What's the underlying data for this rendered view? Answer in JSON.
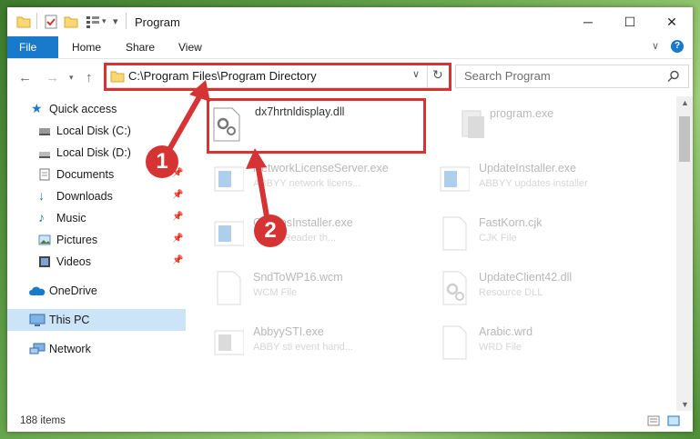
{
  "window": {
    "title": "Program"
  },
  "ribbon": {
    "tabs": [
      "File",
      "Home",
      "Share",
      "View"
    ]
  },
  "address": {
    "path": "C:\\Program Files\\Program Directory"
  },
  "search": {
    "placeholder": "Search Program"
  },
  "sidebar": {
    "items": [
      {
        "label": "Quick access",
        "icon": "star-icon",
        "pinned": false
      },
      {
        "label": "Local Disk (C:)",
        "icon": "drive-icon",
        "pinned": false
      },
      {
        "label": "Local Disk (D:)",
        "icon": "drive-icon",
        "pinned": false
      },
      {
        "label": "Documents",
        "icon": "documents-icon",
        "pinned": true
      },
      {
        "label": "Downloads",
        "icon": "downloads-icon",
        "pinned": true
      },
      {
        "label": "Music",
        "icon": "music-icon",
        "pinned": true
      },
      {
        "label": "Pictures",
        "icon": "pictures-icon",
        "pinned": true
      },
      {
        "label": "Videos",
        "icon": "videos-icon",
        "pinned": true
      },
      {
        "label": "OneDrive",
        "icon": "cloud-icon",
        "pinned": false
      },
      {
        "label": "This PC",
        "icon": "computer-icon",
        "pinned": false,
        "selected": true
      },
      {
        "label": "Network",
        "icon": "network-icon",
        "pinned": false
      }
    ]
  },
  "files": [
    {
      "name": "dx7hrtnldisplay.dll",
      "desc": "",
      "icon": "dll-icon",
      "highlighted": true
    },
    {
      "name": "program.exe",
      "desc": "",
      "icon": "exe-icon"
    },
    {
      "name": "NetworkLicenseServer.exe",
      "desc": "ABBYY network licens...",
      "icon": "app-icon"
    },
    {
      "name": "UpdateInstaller.exe",
      "desc": "ABBYY updates installer",
      "icon": "app-icon"
    },
    {
      "name": "CommsInstaller.exe",
      "desc": "... FineReader th...",
      "icon": "app-icon"
    },
    {
      "name": "FastKorn.cjk",
      "desc": "CJK File",
      "icon": "file-icon"
    },
    {
      "name": "SndToWP16.wcm",
      "desc": "WCM File",
      "icon": "file-icon"
    },
    {
      "name": "UpdateClient42.dll",
      "desc": "Resource DLL",
      "icon": "dll-icon"
    },
    {
      "name": "AbbyySTI.exe",
      "desc": "ABBY sti event hand...",
      "icon": "app-icon"
    },
    {
      "name": "Arabic.wrd",
      "desc": "WRD File",
      "icon": "file-icon"
    }
  ],
  "status": {
    "count": "188 items"
  },
  "callouts": [
    "1",
    "2"
  ],
  "colors": {
    "accent": "#1979ca",
    "callout": "#d63434"
  }
}
